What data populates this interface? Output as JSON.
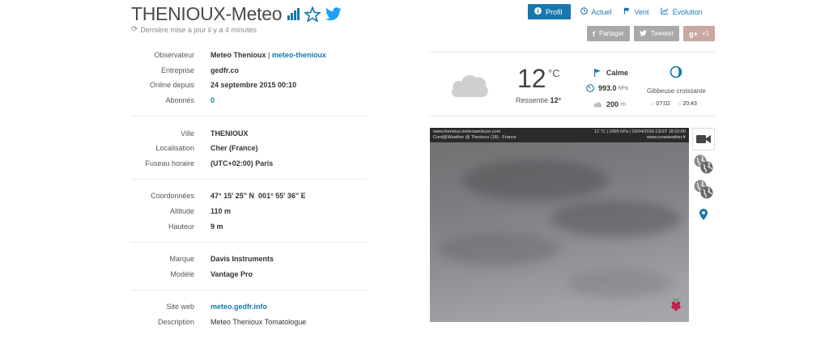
{
  "header": {
    "title": "THENIOUX-Meteo",
    "updated": "Dernière mise à jour il y a 4 minutes"
  },
  "nav": {
    "items": [
      {
        "label": "Profil",
        "icon": "info-icon",
        "active": true
      },
      {
        "label": "Actuel",
        "icon": "clock-icon"
      },
      {
        "label": "Vent",
        "icon": "flag-icon"
      },
      {
        "label": "Évolution",
        "icon": "chart-icon"
      }
    ]
  },
  "share": {
    "facebook": "Partager",
    "twitter": "Tweeter",
    "gplus": "+1"
  },
  "info": {
    "observateur_label": "Observateur",
    "observateur_value": "Meteo Thenioux",
    "observateur_sep": "|",
    "observateur_link": "meteo-thenioux",
    "entreprise_label": "Entreprise",
    "entreprise_value": "gedfr.co",
    "online_label": "Online depuis",
    "online_value": "24 septembre 2015 00:10",
    "abonnes_label": "Abonnés",
    "abonnes_value": "0",
    "ville_label": "Ville",
    "ville_value": "THENIOUX",
    "localisation_label": "Localisation",
    "localisation_value": "Cher (France)",
    "fuseau_label": "Fuseau horaire",
    "fuseau_value": "(UTC+02:00) Paris",
    "coord_label": "Coordonnées",
    "coord_value": "47° 15' 25'' N  001° 55' 36'' E",
    "altitude_label": "Altitude",
    "altitude_value": "110 m",
    "hauteur_label": "Hauteur",
    "hauteur_value": "9 m",
    "marque_label": "Marque",
    "marque_value": "Davis Instruments",
    "modele_label": "Modèle",
    "modele_value": "Vantage Pro",
    "site_label": "Site web",
    "site_value": "meteo.gedfr.info",
    "desc_label": "Description",
    "desc_value": "Meteo Thenioux Tomatologue"
  },
  "weather": {
    "temp": "12",
    "temp_unit": "°C",
    "feels_label": "Ressentie",
    "feels_value": "12°",
    "wind": "Calme",
    "pressure": "993.0",
    "pressure_unit": "hPa",
    "cloud_height": "200",
    "cloud_unit": "m",
    "moon": "Gibbeuse croissante",
    "sunrise": "07:02",
    "sunset": "20:43"
  },
  "webcam": {
    "line1_left": "www.thenioux.meteoamikuze.com",
    "line2_left": "Cred@Weather @ Thenioux (18) - France",
    "line1_right": "12 °C  |  1005 hPa  |  16/04/2016 CEST 18:10:00",
    "line2_right": "www.creaweather.fr"
  },
  "colors": {
    "accent": "#1778ad",
    "share_grey": "#a9a9a9",
    "twitter_blue": "#1da1f2"
  }
}
